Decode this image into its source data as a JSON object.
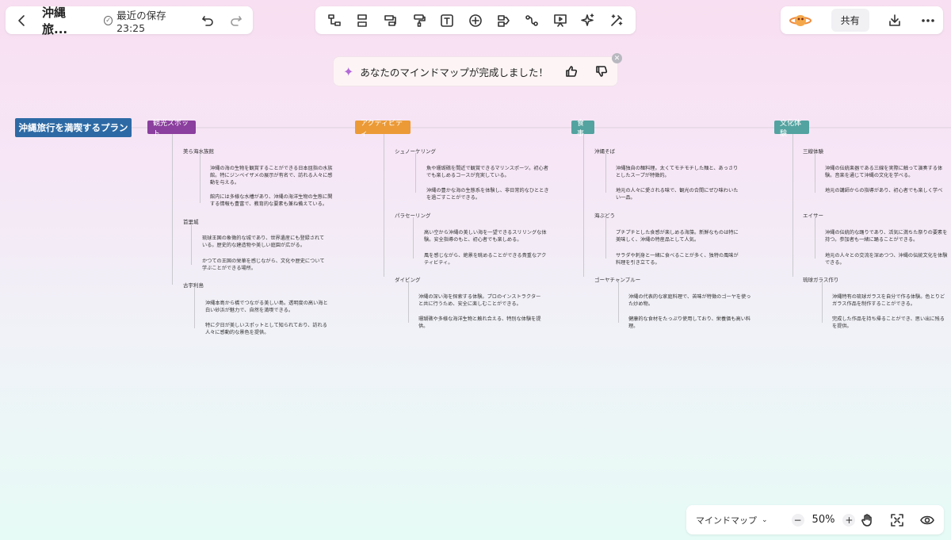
{
  "header": {
    "back_icon": "chevron-left-icon",
    "title": "沖縄旅...",
    "save_status": "最近の保存 23:25"
  },
  "toolbar": {
    "tools": [
      "subnode-icon",
      "sibling-node-icon",
      "summary-icon",
      "format-painter-icon",
      "text-icon",
      "add-icon",
      "relation-icon",
      "connect-icon",
      "present-icon",
      "ai-sparkle-icon",
      "magic-wand-icon"
    ]
  },
  "right_panel": {
    "logo": "planet-logo",
    "share_label": "共有",
    "download_icon": "download-icon",
    "more_icon": "more-icon"
  },
  "notice": {
    "text": "あなたのマインドマップが完成しました！",
    "like_icon": "thumbs-up-icon",
    "dislike_icon": "thumbs-down-icon",
    "close_icon": "close-icon"
  },
  "mindmap": {
    "root": "沖縄旅行を満喫するプラン",
    "colors": {
      "root": "#2d6aa5",
      "b0": "#8b3f9e",
      "b1": "#eb9a36",
      "b2": "#53a3a0",
      "b3": "#53a3a0"
    },
    "branches": [
      {
        "label": "観光スポット",
        "items": [
          {
            "label": "美ら海水族館",
            "descs": [
              "沖縄の海の生物を観賞することができる日本屈指の水族\n館。特にジンベイザメの展示が有名で、訪れる人々に感\n動を与える。",
              "館内には多様な水槽があり、沖縄の海洋生物の生態に関\nする情報も豊富で、教育的な要素も兼ね備えている。"
            ]
          },
          {
            "label": "首里城",
            "descs": [
              "琉球王国の象徴的な城であり、世界遺産にも登録されて\nいる。歴史的な建造物や美しい庭園が広がる。",
              "かつての王国の栄華を感じながら、文化や歴史について\n学ぶことができる場所。"
            ]
          },
          {
            "label": "古宇利島",
            "descs": [
              "沖縄本島から橋でつながる美しい島。透明度の高い海と\n白い砂浜が魅力で、自然を満喫できる。",
              "特に夕日が美しいスポットとして知られており、訪れる\n人々に感動的な景色を提供。"
            ]
          }
        ]
      },
      {
        "label": "アクティビティ",
        "items": [
          {
            "label": "シュノーケリング",
            "descs": [
              "魚や珊瑚礁を間近で観賞できるマリンスポーツ。初心者\nでも楽しめるコースが充実している。",
              "沖縄の豊かな海の生態系を体験し、非日常的なひととき\nを過ごすことができる。"
            ]
          },
          {
            "label": "パラセーリング",
            "descs": [
              "高い空から沖縄の美しい海を一望できるスリリングな体\n験。安全指導のもと、初心者でも楽しめる。",
              "風を感じながら、絶景を眺めることができる貴重なアク\nティビティ。"
            ]
          },
          {
            "label": "ダイビング",
            "descs": [
              "沖縄の深い海を探索する体験。プロのインストラクター\nと共に行うため、安全に楽しむことができる。",
              "珊瑚礁や多様な海洋生物と触れ合える、特別な体験を提\n供。"
            ]
          }
        ]
      },
      {
        "label": "食事",
        "items": [
          {
            "label": "沖縄そば",
            "descs": [
              "沖縄独自の麺料理。太くてモチモチした麺と、あっさり\nとしたスープが特徴的。",
              "地元の人々に愛される味で、観光の合間にぜひ味わいた\nい一品。"
            ]
          },
          {
            "label": "海ぶどう",
            "descs": [
              "プチプチとした食感が楽しめる海藻。新鮮なものは特に\n美味しく、沖縄の特産品として人気。",
              "サラダや刺身と一緒に食べることが多く、独特の風味が\n料理を引き立てる。"
            ]
          },
          {
            "label": "ゴーヤチャンプルー",
            "descs": [
              "沖縄の代表的な家庭料理で、苦味が特徴のゴーヤを使っ\nた炒め物。",
              "健康的な食材をたっぷり使用しており、栄養価も高い料\n理。"
            ]
          }
        ]
      },
      {
        "label": "文化体験",
        "items": [
          {
            "label": "三線体験",
            "descs": [
              "沖縄の伝統楽器である三線を実際に触って演奏する体\n験。音楽を通じて沖縄の文化を学べる。",
              "地元の講師からの指導があり、初心者でも楽しく学べ"
            ]
          },
          {
            "label": "エイサー",
            "descs": [
              "沖縄の伝統的な踊りであり、活気に満ちた祭りの要素を\n持つ。参加者も一緒に踊ることができる。",
              "地元の人々との交流を深めつつ、沖縄の伝統文化を体験\nできる。"
            ]
          },
          {
            "label": "琉球ガラス作り",
            "descs": [
              "沖縄特有の琉球ガラスを自分で作る体験。色とりど\nガラス作品を制作することができる。",
              "完成した作品を持ち帰ることができ、思い出に残る\nを提供。"
            ]
          }
        ]
      }
    ]
  },
  "bottom": {
    "mode_label": "マインドマップ",
    "zoom_value": "50%",
    "zoom_out_label": "−",
    "zoom_in_label": "+",
    "tools": [
      "hand-icon",
      "fit-screen-icon",
      "eye-icon"
    ]
  }
}
